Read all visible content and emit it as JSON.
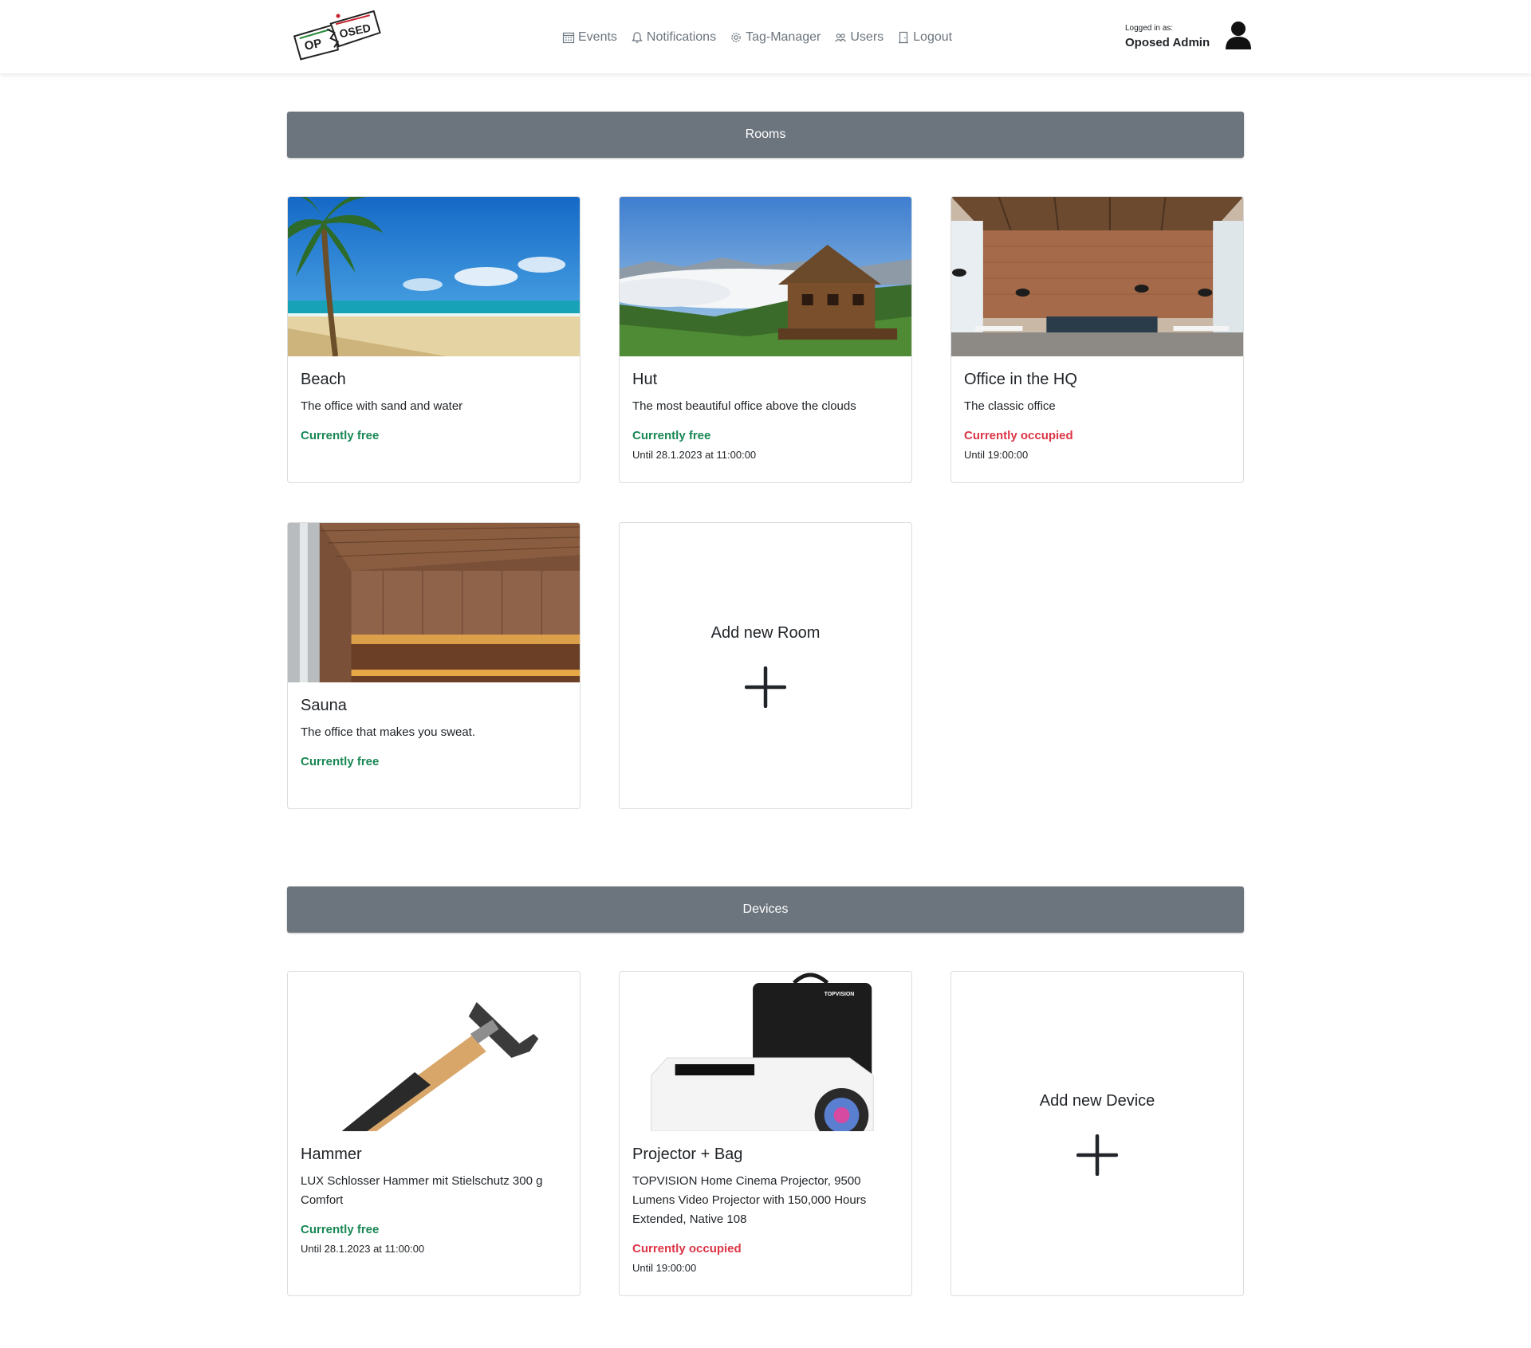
{
  "nav": {
    "items": [
      {
        "label": "Events",
        "icon": "calendar-icon"
      },
      {
        "label": "Notifications",
        "icon": "bell-icon"
      },
      {
        "label": "Tag-Manager",
        "icon": "gear-icon"
      },
      {
        "label": "Users",
        "icon": "users-icon"
      },
      {
        "label": "Logout",
        "icon": "door-icon"
      }
    ],
    "logged_in_label": "Logged in as:",
    "user_name": "Oposed Admin"
  },
  "logo": {
    "text_left": "OP",
    "text_right": "OSED"
  },
  "rooms": {
    "title": "Rooms",
    "items": [
      {
        "name": "Beach",
        "description": "The office with sand and water",
        "status": "Currently free",
        "until": ""
      },
      {
        "name": "Hut",
        "description": "The most beautiful office above the clouds",
        "status": "Currently free",
        "until": "Until 28.1.2023 at 11:00:00"
      },
      {
        "name": "Office in the HQ",
        "description": "The classic office",
        "status": "Currently occupied",
        "until": "Until 19:00:00"
      },
      {
        "name": "Sauna",
        "description": "The office that makes you sweat.",
        "status": "Currently free",
        "until": ""
      }
    ],
    "add_label": "Add new Room"
  },
  "devices": {
    "title": "Devices",
    "items": [
      {
        "name": "Hammer",
        "description": "LUX Schlosser Hammer mit Stielschutz 300 g Comfort",
        "status": "Currently free",
        "until": "Until 28.1.2023 at 11:00:00"
      },
      {
        "name": "Projector + Bag",
        "description": "TOPVISION Home Cinema Projector, 9500 Lumens Video Projector with 150,000 Hours Extended, Native 108",
        "status": "Currently occupied",
        "until": "Until 19:00:00",
        "brand": "TOPVISION"
      }
    ],
    "add_label": "Add new Device"
  },
  "colors": {
    "free": "#198754",
    "occupied": "#dc3545",
    "section": "#6c757d"
  }
}
